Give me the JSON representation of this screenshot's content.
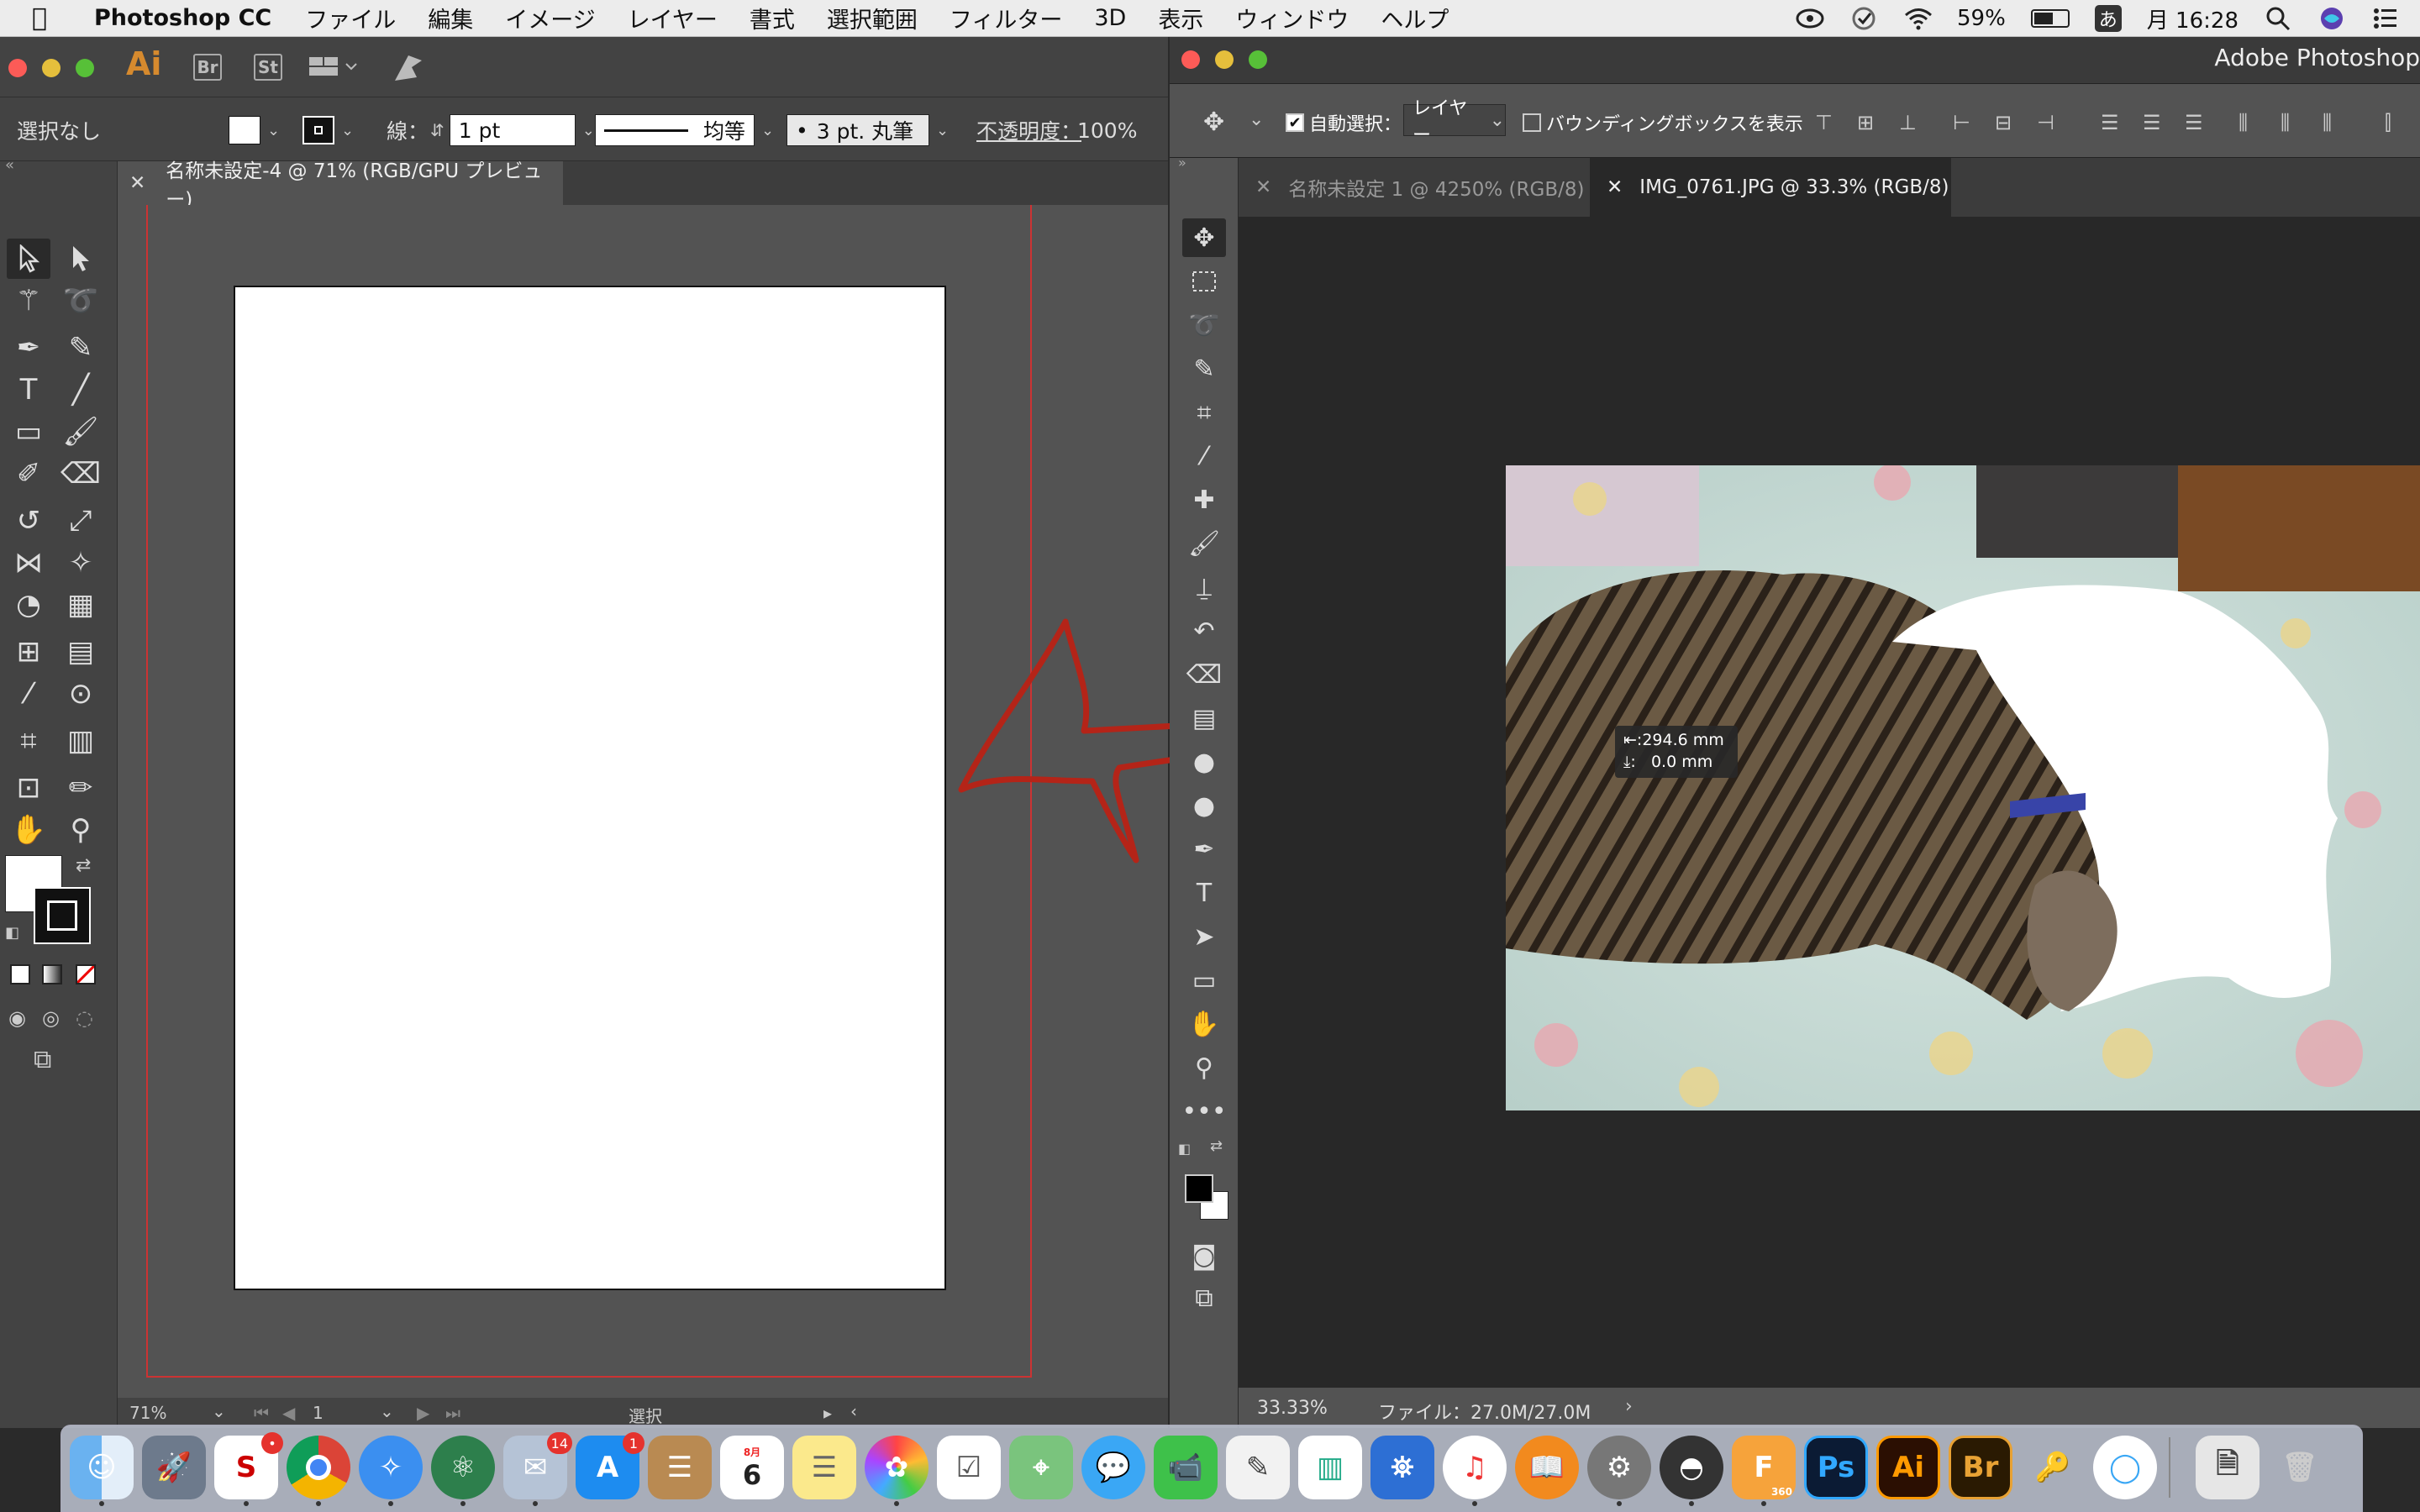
{
  "menubar": {
    "app_name": "Photoshop CC",
    "items": [
      "ファイル",
      "編集",
      "イメージ",
      "レイヤー",
      "書式",
      "選択範囲",
      "フィルター",
      "3D",
      "表示",
      "ウィンドウ",
      "ヘルプ"
    ],
    "battery": "59%",
    "ime": "あ",
    "clock": "月 16:28"
  },
  "illustrator": {
    "logo": "Ai",
    "bridge_label": "Br",
    "stock_label": "St",
    "selection_status": "選択なし",
    "stroke_label": "線：",
    "stroke_width": "1 pt",
    "stroke_profile": "均等",
    "brush": "3 pt. 丸筆",
    "opacity_label": "不透明度：",
    "opacity_value": "100%",
    "document_tab": "名称未設定-4 @ 71% (RGB/GPU プレビュー)",
    "zoom": "71%",
    "artboard_number": "1",
    "status_tool": "選択"
  },
  "photoshop": {
    "window_title": "Adobe Photoshop",
    "auto_select_label": "自動選択：",
    "auto_select_target": "レイヤー",
    "bbox_label": "バウンディングボックスを表示",
    "tabs": [
      {
        "label": "名称未設定 1 @ 4250% (RGB/8)",
        "active": false
      },
      {
        "label": "IMG_0761.JPG @ 33.3% (RGB/8)",
        "active": true
      }
    ],
    "measure_h": "294.6 mm",
    "measure_v": "0.0 mm",
    "zoom": "33.33%",
    "file_info": "ファイル：27.0M/27.0M"
  },
  "dock": {
    "badges": {
      "mail": "14",
      "appstore": "1",
      "calendar_day": "6",
      "calendar_month": "8月",
      "fusion": "360"
    },
    "labels": {
      "ps": "Ps",
      "ai": "Ai",
      "br": "Br"
    }
  },
  "colors": {
    "ai_logo": "#d68a2e",
    "annotation": "#b42418",
    "bleed": "#cc3333"
  }
}
